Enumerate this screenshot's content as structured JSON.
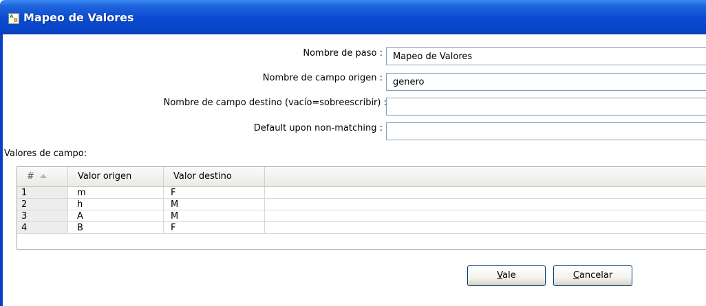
{
  "window": {
    "title": "Mapeo de Valores",
    "icon": "value-mapper-icon",
    "icon_letters": [
      "A",
      "B"
    ]
  },
  "form": {
    "step_name_label": "Nombre de paso :",
    "step_name_value": "Mapeo de Valores",
    "source_field_label": "Nombre de campo origen :",
    "source_field_value": "genero",
    "target_field_label": "Nombre de campo destino (vacío=sobreescribir) :",
    "target_field_value": "",
    "default_label": "Default upon non-matching :",
    "default_value": ""
  },
  "values_section": {
    "label": "Valores de campo:",
    "columns": [
      "#",
      "Valor origen",
      "Valor destino"
    ],
    "rows": [
      {
        "num": "1",
        "source": "m",
        "target": "F"
      },
      {
        "num": "2",
        "source": "h",
        "target": "M"
      },
      {
        "num": "3",
        "source": "A",
        "target": "M"
      },
      {
        "num": "4",
        "source": "B",
        "target": "F"
      }
    ]
  },
  "buttons": {
    "ok_mnemonic": "V",
    "ok_rest": "ale",
    "cancel_mnemonic": "C",
    "cancel_rest": "ancelar"
  },
  "colors": {
    "titlebar": "#0a4ad0",
    "field_border": "#7f9db9",
    "button_border": "#003c74"
  }
}
